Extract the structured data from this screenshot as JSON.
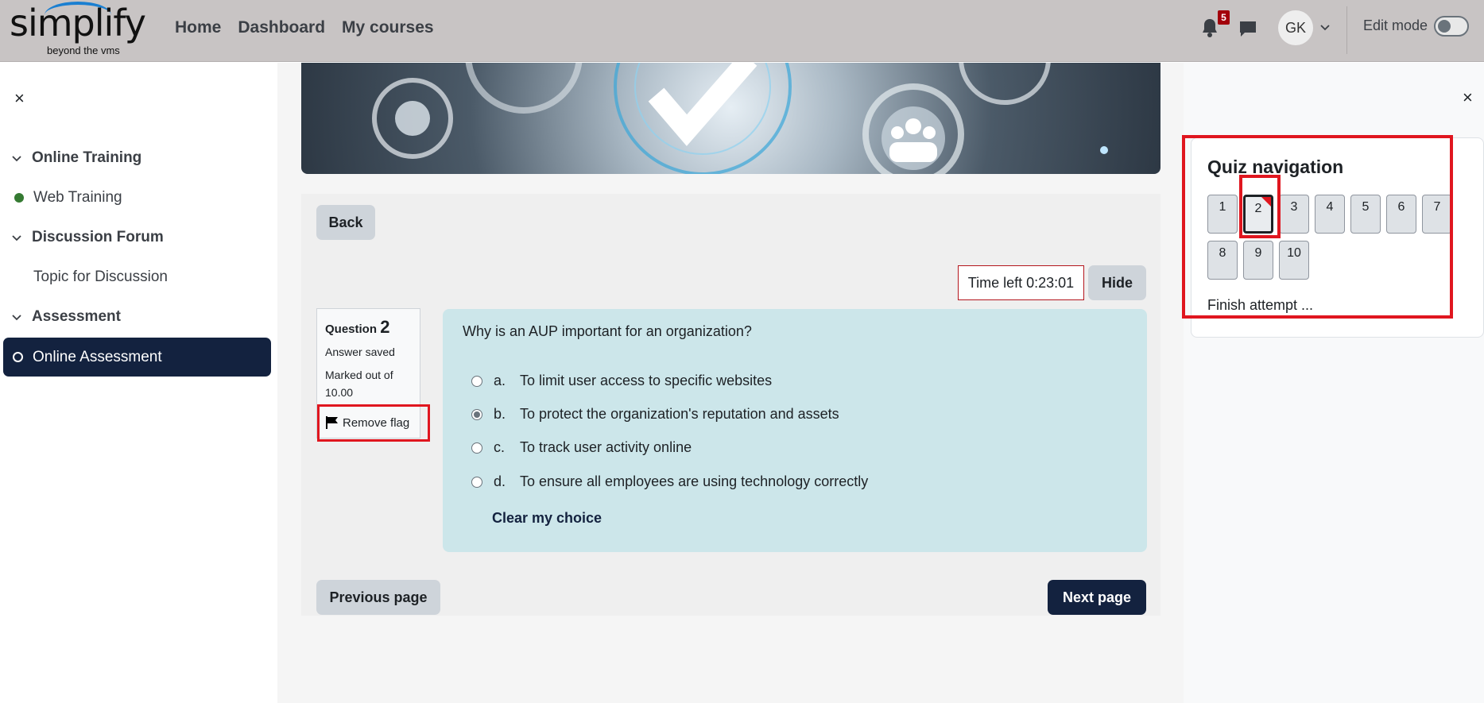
{
  "header": {
    "logo_text": "simplify",
    "logo_tagline": "beyond the vms",
    "nav": [
      "Home",
      "Dashboard",
      "My courses"
    ],
    "notifications_count": "5",
    "avatar_initials": "GK",
    "edit_mode_label": "Edit mode",
    "edit_mode_on": false
  },
  "left_drawer": {
    "close": "×",
    "sections": [
      {
        "title": "Online Training",
        "items": [
          "Web Training"
        ]
      },
      {
        "title": "Discussion Forum",
        "items": [
          "Topic for Discussion"
        ]
      },
      {
        "title": "Assessment",
        "items": [
          "Online Assessment"
        ]
      }
    ]
  },
  "quiz": {
    "back_label": "Back",
    "timer_label": "Time left 0:23:01",
    "hide_label": "Hide",
    "question_info": {
      "question_label": "Question",
      "question_number": "2",
      "state": "Answer saved",
      "marked_out_of": "Marked out of 10.00",
      "flag_label": "Remove flag"
    },
    "question_text": "Why is an AUP important for an organization?",
    "options": [
      {
        "letter": "a.",
        "text": "To limit user access to specific websites",
        "selected": false
      },
      {
        "letter": "b.",
        "text": "To protect the organization's reputation and assets",
        "selected": true
      },
      {
        "letter": "c.",
        "text": "To track user activity online",
        "selected": false
      },
      {
        "letter": "d.",
        "text": "To ensure all employees are using technology correctly",
        "selected": false
      }
    ],
    "clear_choice_label": "Clear my choice",
    "previous_label": "Previous page",
    "next_label": "Next page"
  },
  "quiz_navigation": {
    "close": "×",
    "title": "Quiz navigation",
    "questions": [
      "1",
      "2",
      "3",
      "4",
      "5",
      "6",
      "7",
      "8",
      "9",
      "10"
    ],
    "current": "2",
    "flagged": [
      "2"
    ],
    "finish_label": "Finish attempt ..."
  },
  "colors": {
    "header_bg": "#c8c4c4",
    "primary": "#13223f",
    "highlight": "#e0161f",
    "answer_bg": "#cce6ea"
  }
}
